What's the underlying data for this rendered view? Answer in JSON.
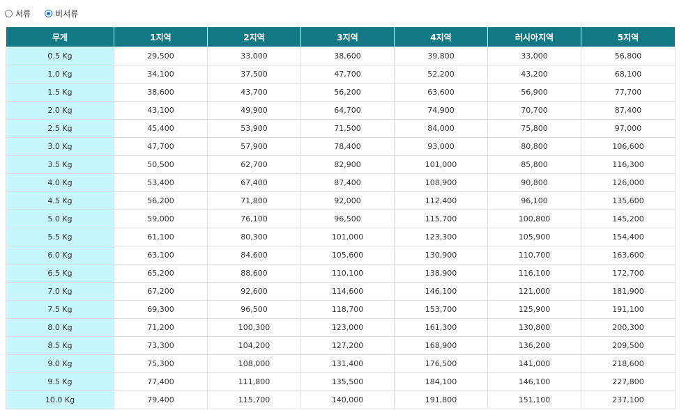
{
  "radio": {
    "options": [
      {
        "label": "서류",
        "checked": false
      },
      {
        "label": "비서류",
        "checked": true
      }
    ]
  },
  "table": {
    "headers": [
      "무게",
      "1지역",
      "2지역",
      "3지역",
      "4지역",
      "러시아지역",
      "5지역"
    ],
    "rows": [
      [
        "0.5 Kg",
        "29,500",
        "33,000",
        "38,600",
        "39,800",
        "33,000",
        "56,800"
      ],
      [
        "1.0 Kg",
        "34,100",
        "37,500",
        "47,700",
        "52,200",
        "43,200",
        "68,100"
      ],
      [
        "1.5 Kg",
        "38,600",
        "43,700",
        "56,200",
        "63,600",
        "56,900",
        "77,700"
      ],
      [
        "2.0 Kg",
        "43,100",
        "49,900",
        "64,700",
        "74,900",
        "70,700",
        "87,400"
      ],
      [
        "2.5 Kg",
        "45,400",
        "53,900",
        "71,500",
        "84,000",
        "75,800",
        "97,000"
      ],
      [
        "3.0 Kg",
        "47,700",
        "57,900",
        "78,400",
        "93,000",
        "80,800",
        "106,600"
      ],
      [
        "3.5 Kg",
        "50,500",
        "62,700",
        "82,900",
        "101,000",
        "85,800",
        "116,300"
      ],
      [
        "4.0 Kg",
        "53,400",
        "67,400",
        "87,400",
        "108,900",
        "90,800",
        "126,000"
      ],
      [
        "4.5 Kg",
        "56,200",
        "71,800",
        "92,000",
        "112,400",
        "96,100",
        "135,600"
      ],
      [
        "5.0 Kg",
        "59,000",
        "76,100",
        "96,500",
        "115,700",
        "100,800",
        "145,200"
      ],
      [
        "5.5 Kg",
        "61,100",
        "80,300",
        "101,000",
        "123,300",
        "105,900",
        "154,400"
      ],
      [
        "6.0 Kg",
        "63,100",
        "84,600",
        "105,600",
        "130,900",
        "110,700",
        "163,600"
      ],
      [
        "6.5 Kg",
        "65,200",
        "88,600",
        "110,100",
        "138,900",
        "116,100",
        "172,700"
      ],
      [
        "7.0 Kg",
        "67,200",
        "92,600",
        "114,600",
        "146,100",
        "121,000",
        "181,900"
      ],
      [
        "7.5 Kg",
        "69,300",
        "96,500",
        "118,700",
        "153,700",
        "125,900",
        "191,100"
      ],
      [
        "8.0 Kg",
        "71,200",
        "100,300",
        "123,000",
        "161,300",
        "130,800",
        "200,300"
      ],
      [
        "8.5 Kg",
        "73,300",
        "104,200",
        "127,200",
        "168,900",
        "136,200",
        "209,500"
      ],
      [
        "9.0 Kg",
        "75,300",
        "108,000",
        "131,400",
        "176,500",
        "141,000",
        "218,600"
      ],
      [
        "9.5 Kg",
        "77,400",
        "111,800",
        "135,500",
        "184,100",
        "146,100",
        "227,800"
      ],
      [
        "10.0 Kg",
        "79,400",
        "115,700",
        "140,000",
        "191,800",
        "151,100",
        "237,100"
      ]
    ]
  },
  "colors": {
    "header_bg": "#137985",
    "header_text": "#ffffff",
    "weight_cell_bg": "#c7f6fc",
    "border": "#dedede",
    "radio_accent": "#1a73e8"
  }
}
